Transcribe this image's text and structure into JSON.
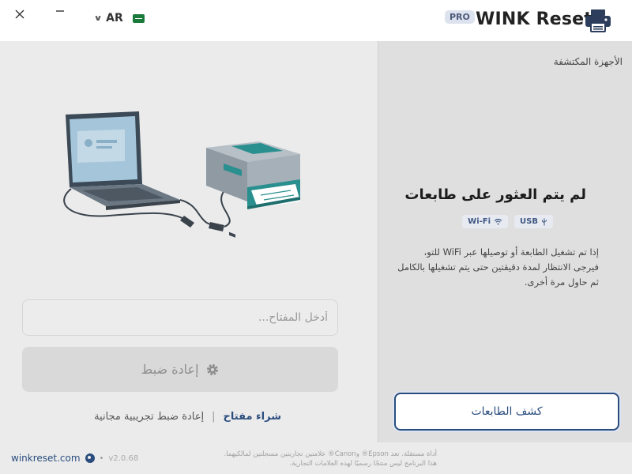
{
  "titlebar": {
    "close_icon": "close-icon",
    "minimize_icon": "minimize-icon",
    "language": "AR",
    "pro_badge": "PRO",
    "app_title": "WINK Reset"
  },
  "main": {
    "key_placeholder": "أدخل المفتاح...",
    "reset_button": "إعادة ضبط",
    "buy_key": "شراء مفتاح",
    "separator": "|",
    "free_trial": "إعادة ضبط تجريبية مجانية"
  },
  "panel": {
    "title": "الأجهزة المكتشفة",
    "empty_title": "لم يتم العثور على طابعات",
    "badge_usb": "USB",
    "badge_wifi": "Wi-Fi",
    "empty_desc": "إذا تم تشغيل الطابعة أو توصيلها عبر WiFi للتو، فيرجى الانتظار لمدة دقيقتين حتى يتم تشغيلها بالكامل ثم حاول مرة أخرى.",
    "scan_button": "كشف الطابعات"
  },
  "footer": {
    "website": "winkreset.com",
    "bullet": "•",
    "version": "v2.0.68",
    "legal_line1": "أداة مستقلة. تعد Epson® وCanon® علامتين تجاريتين مسجلتين لمالكيهما.",
    "legal_line2": "هذا البرنامج ليس منتجًا رسميًا لهذه العلامات التجارية."
  },
  "colors": {
    "accent": "#2a4d7e",
    "teal": "#2a8f8f"
  }
}
